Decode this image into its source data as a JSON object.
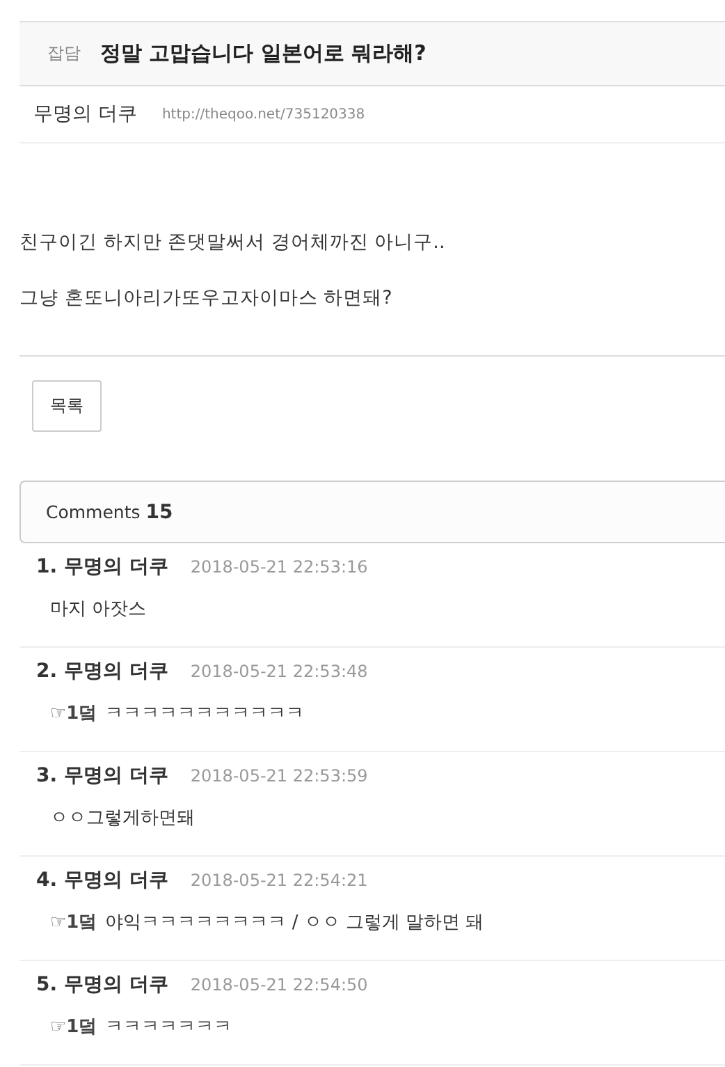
{
  "post": {
    "category": "잡담",
    "title": "정말 고맙습니다 일본어로 뭐라해?",
    "author": "무명의 더쿠",
    "url": "http://theqoo.net/735120338",
    "paragraphs": [
      "친구이긴 하지만 존댓말써서 경어체까진 아니구..",
      "그냥 혼또니아리가또우고자이마스 하면돼?"
    ]
  },
  "list_button": "목록",
  "comments_header": {
    "label": "Comments",
    "count": "15"
  },
  "comments": [
    {
      "number": "1.",
      "author": "무명의 더쿠",
      "time": "2018-05-21 22:53:16",
      "body": "마지 아잣스"
    },
    {
      "number": "2.",
      "author": "무명의 더쿠",
      "time": "2018-05-21 22:53:48",
      "reply_to": "☞1덬",
      "body": "ㅋㅋㅋㅋㅋㅋㅋㅋㅋㅋㅋ"
    },
    {
      "number": "3.",
      "author": "무명의 더쿠",
      "time": "2018-05-21 22:53:59",
      "body": "ㅇㅇ그렇게하면돼"
    },
    {
      "number": "4.",
      "author": "무명의 더쿠",
      "time": "2018-05-21 22:54:21",
      "reply_to": "☞1덬",
      "body": "야익ㅋㅋㅋㅋㅋㅋㅋㅋ / ㅇㅇ 그렇게 말하면 돼"
    },
    {
      "number": "5.",
      "author": "무명의 더쿠",
      "time": "2018-05-21 22:54:50",
      "reply_to": "☞1덬",
      "body": "ㅋㅋㅋㅋㅋㅋㅋ"
    }
  ]
}
